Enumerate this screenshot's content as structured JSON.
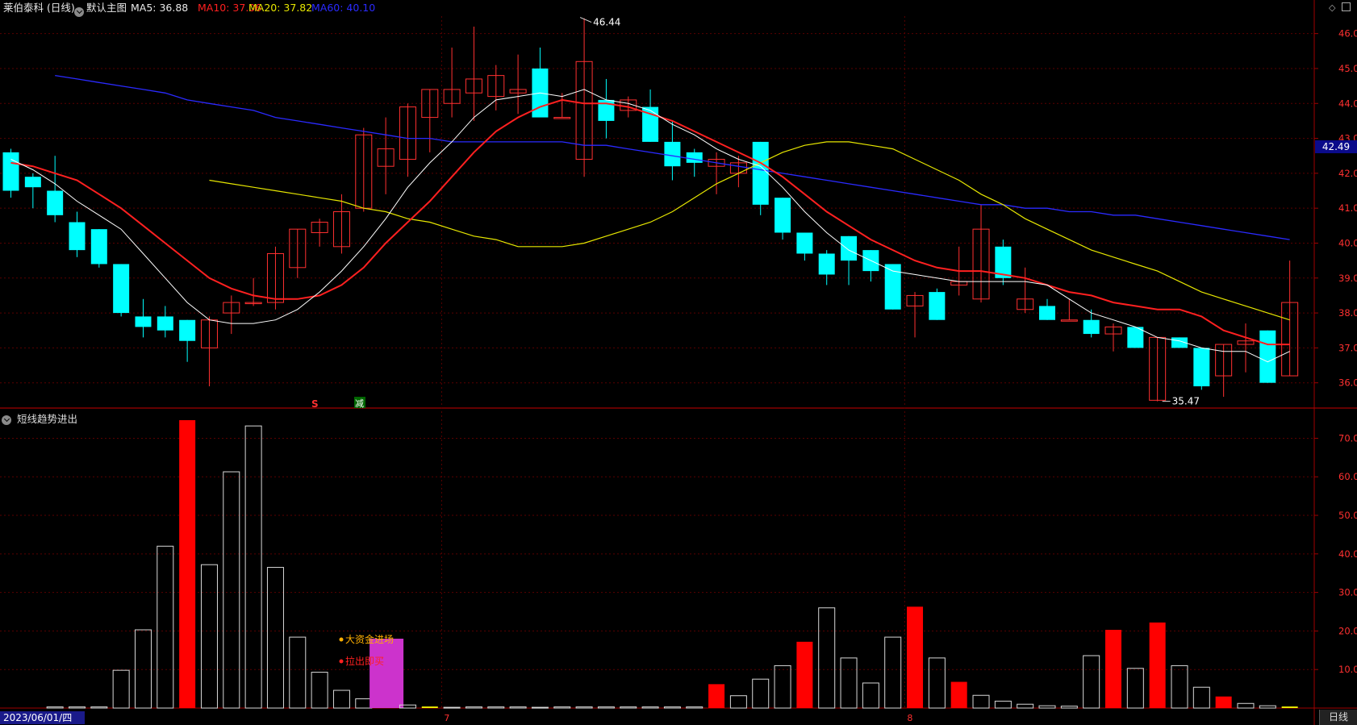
{
  "header": {
    "stock": "莱伯泰科 (日线)",
    "template": "默认主图",
    "ma5": "MA5: 36.88",
    "ma10": "MA10: 37.06",
    "ma20": "MA20: 37.82",
    "ma60": "MA60: 40.10",
    "ma_colors": {
      "ma5": "#ffffff",
      "ma10": "#ff2020",
      "ma20": "#e6e600",
      "ma60": "#2a2aff"
    }
  },
  "price_tag": "42.49",
  "indicator": {
    "title": "短线趋势进出",
    "signal_label_1": "大资金进场",
    "signal_label_2": "拉出即买",
    "signal_colors": {
      "label1": "#ffb000",
      "label2": "#ff2020",
      "bar": "#cc33cc"
    }
  },
  "markers": {
    "s": "S",
    "reduce": "减"
  },
  "footer": {
    "date": "2023/06/01/四",
    "period": "日线"
  },
  "month_labels": [
    "7",
    "8"
  ],
  "annotations": {
    "high": "46.44",
    "low": "35.47"
  },
  "chart_data": [
    {
      "type": "candlestick",
      "title": "莱伯泰科 (日线)",
      "ylim": [
        35.3,
        46.5
      ],
      "y_ticks": [
        "46.00",
        "45.00",
        "44.00",
        "43.00",
        "42.00",
        "41.00",
        "40.00",
        "39.00",
        "38.00",
        "37.00",
        "36.00"
      ],
      "ohlc": [
        [
          42.6,
          42.7,
          41.3,
          41.5
        ],
        [
          41.9,
          42.0,
          41.0,
          41.6
        ],
        [
          41.5,
          42.5,
          40.6,
          40.8
        ],
        [
          40.6,
          40.9,
          39.6,
          39.8
        ],
        [
          40.4,
          40.4,
          39.3,
          39.4
        ],
        [
          39.4,
          39.4,
          37.9,
          38.0
        ],
        [
          37.9,
          38.4,
          37.3,
          37.6
        ],
        [
          37.9,
          38.2,
          37.3,
          37.5
        ],
        [
          37.8,
          37.8,
          36.6,
          37.2
        ],
        [
          37.0,
          37.9,
          35.9,
          37.8
        ],
        [
          38.0,
          38.5,
          37.4,
          38.3
        ],
        [
          38.3,
          39.0,
          38.2,
          38.3
        ],
        [
          38.3,
          39.9,
          38.1,
          39.7
        ],
        [
          39.3,
          40.4,
          39.0,
          40.4
        ],
        [
          40.3,
          40.7,
          39.9,
          40.6
        ],
        [
          39.9,
          41.4,
          39.7,
          40.9
        ],
        [
          41.0,
          43.3,
          40.9,
          43.1
        ],
        [
          42.2,
          43.6,
          41.4,
          42.7
        ],
        [
          42.4,
          44.0,
          41.9,
          43.9
        ],
        [
          43.6,
          44.4,
          42.6,
          44.4
        ],
        [
          44.0,
          45.6,
          43.6,
          44.4
        ],
        [
          44.3,
          46.2,
          43.5,
          44.7
        ],
        [
          44.2,
          45.1,
          43.8,
          44.8
        ],
        [
          44.3,
          45.4,
          43.7,
          44.4
        ],
        [
          45.0,
          45.6,
          43.7,
          43.6
        ],
        [
          43.6,
          44.3,
          43.6,
          43.6
        ],
        [
          42.4,
          46.44,
          41.9,
          45.2
        ],
        [
          44.1,
          44.7,
          43.0,
          43.5
        ],
        [
          43.8,
          44.2,
          43.6,
          44.1
        ],
        [
          43.9,
          44.4,
          42.9,
          42.9
        ],
        [
          42.9,
          43.5,
          41.8,
          42.2
        ],
        [
          42.6,
          42.7,
          41.9,
          42.3
        ],
        [
          42.2,
          42.6,
          41.4,
          42.4
        ],
        [
          42.0,
          42.5,
          41.6,
          42.3
        ],
        [
          42.9,
          42.9,
          40.8,
          41.1
        ],
        [
          41.3,
          41.3,
          40.1,
          40.3
        ],
        [
          40.3,
          40.3,
          39.5,
          39.7
        ],
        [
          39.7,
          39.8,
          38.8,
          39.1
        ],
        [
          40.2,
          40.2,
          38.8,
          39.5
        ],
        [
          39.8,
          39.8,
          38.9,
          39.2
        ],
        [
          39.4,
          39.4,
          38.1,
          38.1
        ],
        [
          38.2,
          38.6,
          37.3,
          38.5
        ],
        [
          38.6,
          38.7,
          37.8,
          37.8
        ],
        [
          38.8,
          39.9,
          38.5,
          38.9
        ],
        [
          38.4,
          41.1,
          38.3,
          40.4
        ],
        [
          39.9,
          40.1,
          38.8,
          39.0
        ],
        [
          38.1,
          39.3,
          38.0,
          38.4
        ],
        [
          38.2,
          38.4,
          37.8,
          37.8
        ],
        [
          37.8,
          38.4,
          37.8,
          37.8
        ],
        [
          37.8,
          38.1,
          37.3,
          37.4
        ],
        [
          37.4,
          37.7,
          36.9,
          37.6
        ],
        [
          37.6,
          37.6,
          37.0,
          37.0
        ],
        [
          35.5,
          37.3,
          35.47,
          37.3
        ],
        [
          37.3,
          37.3,
          37.0,
          37.0
        ],
        [
          37.0,
          37.0,
          35.8,
          35.9
        ],
        [
          36.2,
          37.1,
          35.6,
          37.1
        ],
        [
          37.1,
          37.7,
          36.3,
          37.2
        ],
        [
          37.5,
          37.5,
          36.0,
          36.0
        ],
        [
          36.2,
          39.5,
          36.2,
          38.3
        ]
      ],
      "ma5": [
        42.4,
        42.1,
        41.7,
        41.2,
        40.8,
        40.4,
        39.7,
        39.0,
        38.3,
        37.8,
        37.7,
        37.7,
        37.8,
        38.1,
        38.6,
        39.2,
        39.9,
        40.7,
        41.6,
        42.3,
        42.9,
        43.6,
        44.1,
        44.2,
        44.3,
        44.2,
        44.4,
        44.1,
        44.0,
        43.8,
        43.4,
        43.1,
        42.7,
        42.4,
        42.2,
        41.6,
        40.9,
        40.3,
        39.8,
        39.5,
        39.2,
        39.1,
        39.0,
        38.9,
        38.9,
        38.9,
        38.9,
        38.8,
        38.4,
        38.0,
        37.8,
        37.6,
        37.3,
        37.2,
        37.0,
        36.9,
        36.9,
        36.6,
        36.9
      ],
      "ma10": [
        42.3,
        42.2,
        42.0,
        41.8,
        41.4,
        41.0,
        40.5,
        40.0,
        39.5,
        39.0,
        38.7,
        38.5,
        38.4,
        38.4,
        38.5,
        38.8,
        39.3,
        40.0,
        40.6,
        41.2,
        41.9,
        42.6,
        43.2,
        43.6,
        43.9,
        44.1,
        44.0,
        44.0,
        43.9,
        43.7,
        43.5,
        43.2,
        42.9,
        42.6,
        42.3,
        41.9,
        41.4,
        40.9,
        40.5,
        40.1,
        39.8,
        39.5,
        39.3,
        39.2,
        39.2,
        39.1,
        39.0,
        38.8,
        38.6,
        38.5,
        38.3,
        38.2,
        38.1,
        38.1,
        37.9,
        37.5,
        37.3,
        37.1,
        37.1
      ],
      "ma20": [
        41.8,
        41.7,
        41.6,
        41.5,
        41.4,
        41.3,
        41.2,
        41.0,
        40.9,
        40.7,
        40.6,
        40.4,
        40.2,
        40.1,
        39.9,
        39.9,
        39.9,
        40.0,
        40.2,
        40.4,
        40.6,
        40.9,
        41.3,
        41.7,
        42.0,
        42.3,
        42.6,
        42.8,
        42.9,
        42.9,
        42.8,
        42.7,
        42.4,
        42.1,
        41.8,
        41.4,
        41.1,
        40.7,
        40.4,
        40.1,
        39.8,
        39.6,
        39.4,
        39.2,
        38.9,
        38.6,
        38.4,
        38.2,
        38.0,
        37.8
      ],
      "ma60": [
        44.8,
        44.7,
        44.6,
        44.5,
        44.4,
        44.3,
        44.1,
        44.0,
        43.9,
        43.8,
        43.6,
        43.5,
        43.4,
        43.3,
        43.2,
        43.1,
        43.0,
        43.0,
        42.9,
        42.9,
        42.9,
        42.9,
        42.9,
        42.9,
        42.8,
        42.8,
        42.7,
        42.6,
        42.5,
        42.4,
        42.3,
        42.2,
        42.1,
        42.0,
        41.9,
        41.8,
        41.7,
        41.6,
        41.5,
        41.4,
        41.3,
        41.2,
        41.1,
        41.1,
        41.0,
        41.0,
        40.9,
        40.9,
        40.8,
        40.8,
        40.7,
        40.6,
        40.5,
        40.4,
        40.3,
        40.2,
        40.1
      ]
    },
    {
      "type": "bar",
      "title": "短线趋势进出",
      "ylim": [
        0,
        77
      ],
      "y_ticks": [
        "70.00",
        "60.00",
        "50.00",
        "40.00",
        "30.00",
        "20.00",
        "10.00"
      ],
      "values": [
        0.3,
        0.3,
        0.3,
        9.8,
        20.3,
        42.0,
        74.7,
        37.2,
        61.3,
        73.2,
        36.5,
        18.4,
        9.3,
        4.6,
        2.4,
        18.0,
        0.8,
        0.3,
        0.2,
        0.3,
        0.3,
        0.3,
        0.2,
        0.3,
        0.3,
        0.3,
        0.3,
        0.3,
        0.3,
        0.3,
        6.2,
        3.2,
        7.5,
        11.0,
        17.2,
        26.0,
        13.0,
        6.5,
        18.4,
        26.3,
        13.0,
        6.8,
        3.3,
        1.8,
        1.0,
        0.6,
        0.5,
        13.6,
        20.3,
        10.3,
        22.2,
        11.0,
        5.4,
        3.0,
        1.2,
        0.6,
        0.4
      ],
      "colors": [
        "hollow",
        "hollow",
        "hollow",
        "hollow",
        "hollow",
        "hollow",
        "red",
        "hollow",
        "hollow",
        "hollow",
        "hollow",
        "hollow",
        "hollow",
        "hollow",
        "hollow",
        "purple",
        "hollow",
        "yellow",
        "hollow",
        "hollow",
        "hollow",
        "hollow",
        "hollow",
        "hollow",
        "hollow",
        "hollow",
        "hollow",
        "hollow",
        "hollow",
        "hollow",
        "red",
        "hollow",
        "hollow",
        "hollow",
        "red",
        "hollow",
        "hollow",
        "hollow",
        "hollow",
        "red",
        "hollow",
        "red",
        "hollow",
        "hollow",
        "hollow",
        "hollow",
        "hollow",
        "hollow",
        "red",
        "hollow",
        "red",
        "hollow",
        "hollow",
        "red",
        "hollow",
        "hollow",
        "yellow"
      ]
    }
  ]
}
